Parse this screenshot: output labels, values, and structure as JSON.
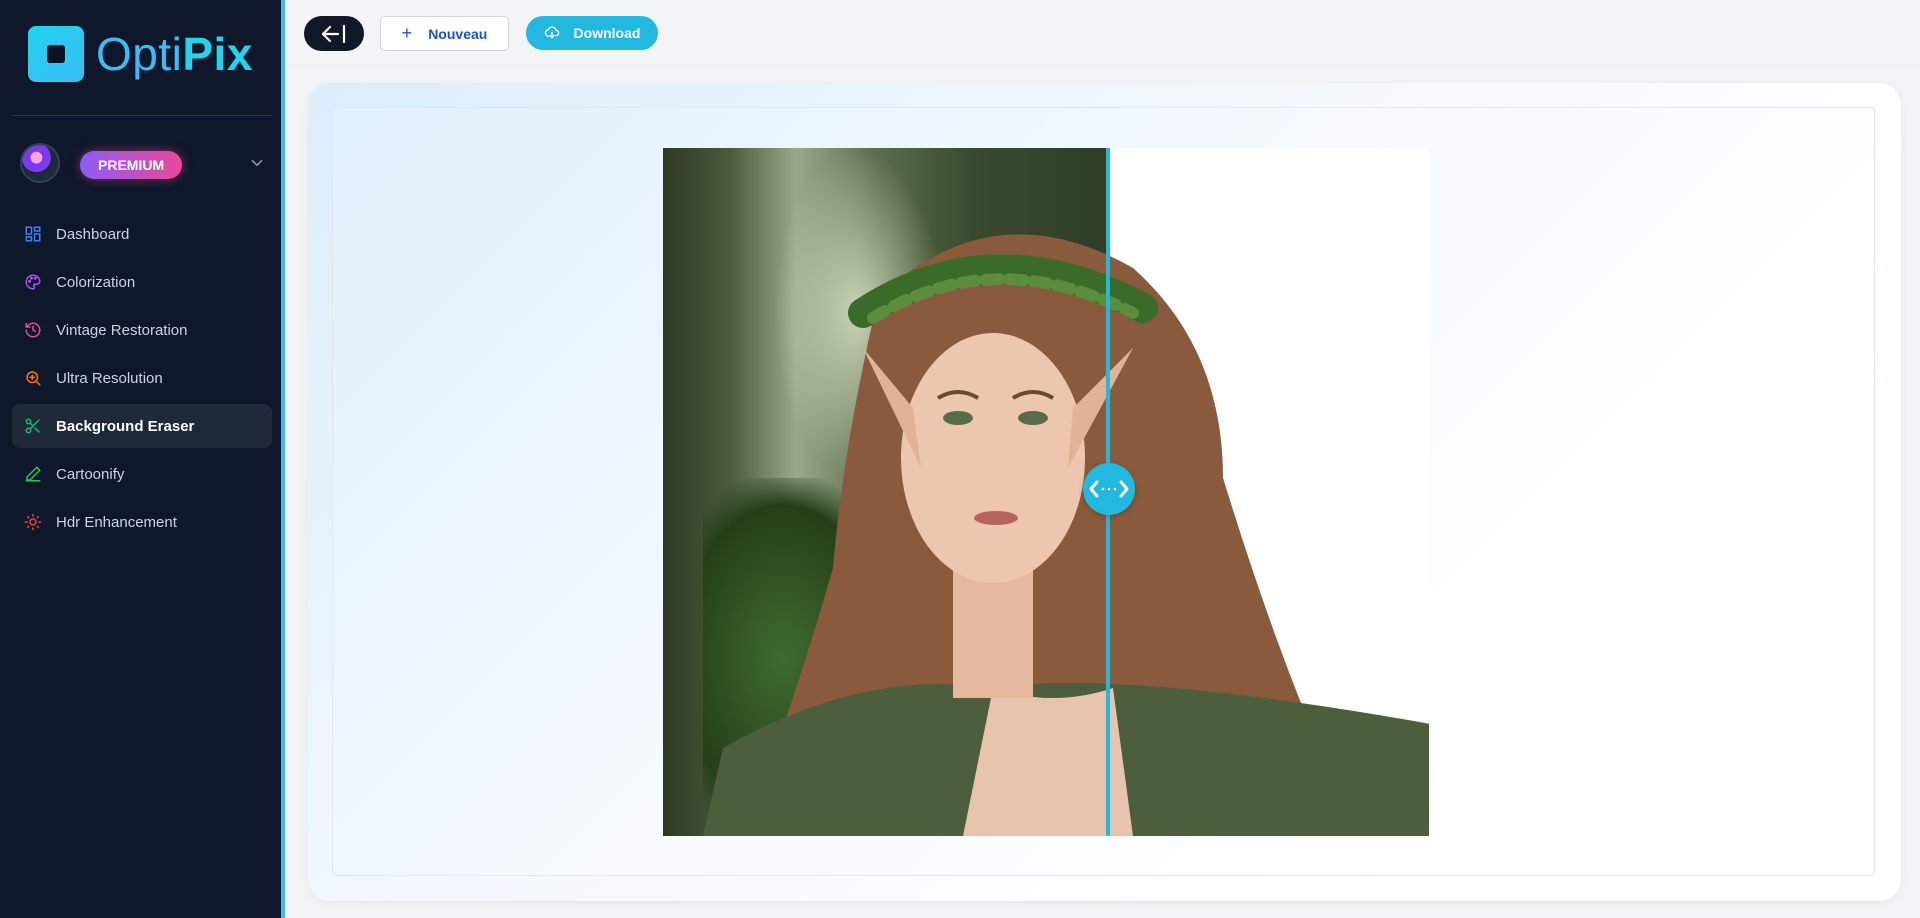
{
  "app": {
    "brand_part1": "Opti",
    "brand_part2": "Pix",
    "accent": "#22b8e0",
    "sidebar_bg": "#0f172a"
  },
  "user": {
    "plan_badge": "PREMIUM"
  },
  "sidebar": {
    "items": [
      {
        "label": "Dashboard",
        "icon": "grid-icon",
        "color": "#3b82f6"
      },
      {
        "label": "Colorization",
        "icon": "palette-icon",
        "color": "#a855f7"
      },
      {
        "label": "Vintage Restoration",
        "icon": "history-icon",
        "color": "#ec4899"
      },
      {
        "label": "Ultra Resolution",
        "icon": "zoom-in-icon",
        "color": "#f97316"
      },
      {
        "label": "Background Eraser",
        "icon": "scissors-icon",
        "color": "#10b981",
        "active": true
      },
      {
        "label": "Cartoonify",
        "icon": "pen-icon",
        "color": "#22c55e"
      },
      {
        "label": "Hdr Enhancement",
        "icon": "sun-icon",
        "color": "#ef4444"
      }
    ]
  },
  "toolbar": {
    "new_label": "Nouveau",
    "download_label": "Download"
  },
  "compare": {
    "split_fraction": 0.58
  }
}
